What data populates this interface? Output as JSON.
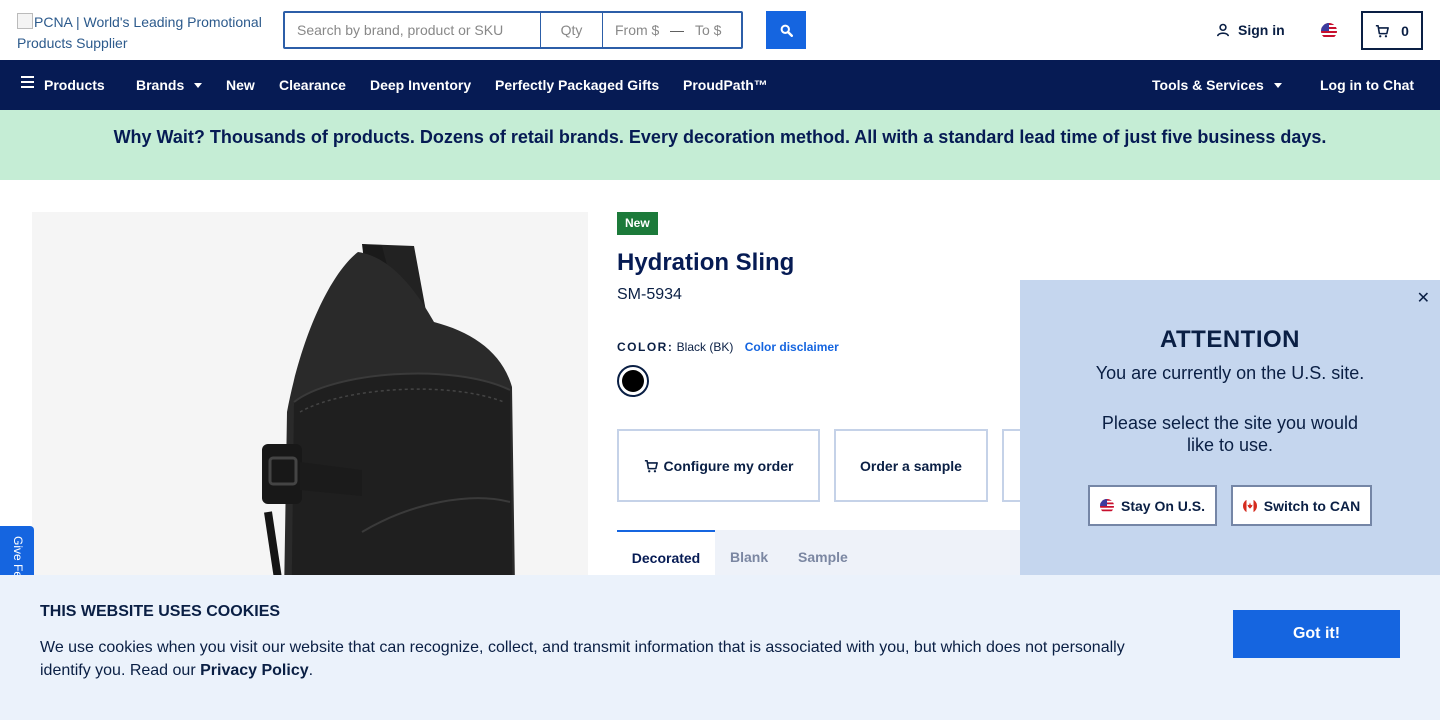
{
  "header": {
    "logo_alt": "PCNA | World's Leading Promotional Products Supplier",
    "search_placeholder": "Search by brand, product or SKU",
    "qty_placeholder": "Qty",
    "price_from_placeholder": "From $",
    "price_to_placeholder": "To $",
    "price_separator": "—",
    "search_icon": "search-icon",
    "signin_label": "Sign in",
    "locale_flag": "us-flag-icon",
    "cart_count": "0"
  },
  "nav": {
    "items": [
      {
        "label": "Products"
      },
      {
        "label": "Brands"
      },
      {
        "label": "New"
      },
      {
        "label": "Clearance"
      },
      {
        "label": "Deep Inventory"
      },
      {
        "label": "Perfectly Packaged Gifts"
      },
      {
        "label": "ProudPath™"
      }
    ],
    "tools_label": "Tools & Services",
    "chat_label": "Log in to Chat"
  },
  "banner": {
    "text": "Why Wait? Thousands of products. Dozens of retail brands. Every decoration method. All with a standard lead time of just five business days."
  },
  "product": {
    "badge": "New",
    "title": "Hydration Sling",
    "sku": "SM-5934",
    "color_label": "COLOR:",
    "color_value": "Black (BK)",
    "color_disclaimer": "Color disclaimer",
    "swatch_color": "#000000",
    "configure_label": "Configure my order",
    "sample_label": "Order a sample",
    "tabs": [
      {
        "label": "Decorated"
      },
      {
        "label": "Blank"
      },
      {
        "label": "Sample"
      }
    ]
  },
  "attention": {
    "title": "ATTENTION",
    "line1": "You are currently on the U.S. site.",
    "line2": "Please select the site you would like to use.",
    "stay_label": "Stay On U.S.",
    "switch_label": "Switch to CAN"
  },
  "feedback": {
    "label": "Give Feedback"
  },
  "cookie": {
    "title": "THIS WEBSITE USES COOKIES",
    "text": "We use cookies when you visit our website that can recognize, collect, and transmit information that is associated with you, but which does not personally identify you. Read our ",
    "link": "Privacy Policy",
    "tail": ".",
    "button": "Got it!"
  },
  "colors": {
    "nav_bg": "#061b54",
    "accent": "#1565e0",
    "banner_bg": "#c5edd5",
    "new_badge": "#1c7a3a",
    "modal_bg": "#c5d6ee",
    "cookie_bg": "#ebf2fb"
  }
}
